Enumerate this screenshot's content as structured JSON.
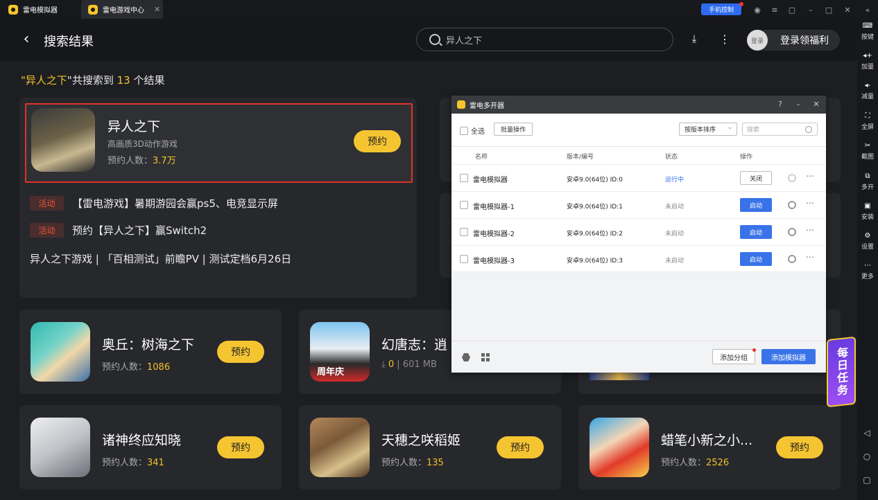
{
  "titlebar": {
    "tabs": [
      {
        "label": "雷电模拟器"
      },
      {
        "label": "雷电游戏中心"
      }
    ],
    "phone_control": "手机控制"
  },
  "header": {
    "title": "搜索结果",
    "search_value": "异人之下",
    "login": "登录领福利",
    "avatar": "登录"
  },
  "summary": {
    "q_open": "\"",
    "keyword": "异人之下",
    "mid": "\"共搜索到 ",
    "count": "13",
    "tail": " 个结果"
  },
  "featured": {
    "name": "异人之下",
    "subtitle": "高画质3D动作游戏",
    "reserve_label": "预约人数：",
    "reserve_count": "3.7万",
    "button": "预约",
    "activities": [
      {
        "badge": "活动",
        "text": "【雷电游戏】暑期游园会赢ps5、电竞显示屏"
      },
      {
        "badge": "活动",
        "text": "预约【异人之下】赢Switch2"
      }
    ],
    "desc": "异人之下游戏 | 「百相测试」前瞻PV | 测试定档6月26日"
  },
  "games": [
    {
      "name": "奥丘：树海之下",
      "label": "预约人数：",
      "count": "1086",
      "button": "预约"
    },
    {
      "name": "幻唐志：逍",
      "size_count": "0",
      "size": "601 MB"
    },
    {
      "name": "诸神终应知晓",
      "label": "预约人数：",
      "count": "341",
      "button": "预约"
    },
    {
      "name": "天穗之咲稻姬",
      "label": "预约人数：",
      "count": "135",
      "button": "预约"
    },
    {
      "name": "蜡笔小新之小...",
      "label": "预约人数：",
      "count": "2526",
      "button": "预约"
    }
  ],
  "badge_text": "周年庆",
  "multi": {
    "title": "雷电多开器",
    "select_all": "全选",
    "batch": "批量操作",
    "sort": "按版本排序",
    "search_placeholder": "搜索",
    "cols": {
      "name": "名称",
      "version": "版本/编号",
      "status": "状态",
      "action": "操作"
    },
    "rows": [
      {
        "name": "雷电模拟器",
        "version": "安卓9.0(64位)  ID:0",
        "status": "运行中",
        "action": "关闭"
      },
      {
        "name": "雷电模拟器-1",
        "version": "安卓9.0(64位)  ID:1",
        "status": "未启动",
        "action": "启动"
      },
      {
        "name": "雷电模拟器-2",
        "version": "安卓9.0(64位)  ID:2",
        "status": "未启动",
        "action": "启动"
      },
      {
        "name": "雷电模拟器-3",
        "version": "安卓9.0(64位)  ID:3",
        "status": "未启动",
        "action": "启动"
      }
    ],
    "add_group": "添加分组",
    "add_emulator": "添加模拟器"
  },
  "daily_task": "每日任务",
  "sidebar": [
    {
      "label": "按键"
    },
    {
      "label": "加量"
    },
    {
      "label": "减量"
    },
    {
      "label": "全屏"
    },
    {
      "label": "截图"
    },
    {
      "label": "多开"
    },
    {
      "label": "安装"
    },
    {
      "label": "设置"
    },
    {
      "label": "更多"
    }
  ],
  "colors": {
    "accent": "#f5c431",
    "primary": "#3a73e8",
    "highlight_border": "#e0322c"
  }
}
